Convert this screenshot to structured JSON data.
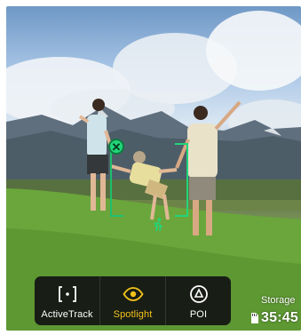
{
  "modes": [
    {
      "label": "ActiveTrack",
      "icon": "target-bracket-icon",
      "active": false
    },
    {
      "label": "Spotlight",
      "icon": "eye-icon",
      "active": true
    },
    {
      "label": "POI",
      "icon": "poi-icon",
      "active": false
    }
  ],
  "storage": {
    "label": "Storage",
    "time": "35:45",
    "icon": "sd-card-icon"
  },
  "tracking": {
    "close_icon": "close-icon",
    "subject_icon": "running-person-icon"
  },
  "colors": {
    "accent_active": "#f3c21a",
    "tracking_green": "#22d57a",
    "bar_background": "#121212"
  }
}
